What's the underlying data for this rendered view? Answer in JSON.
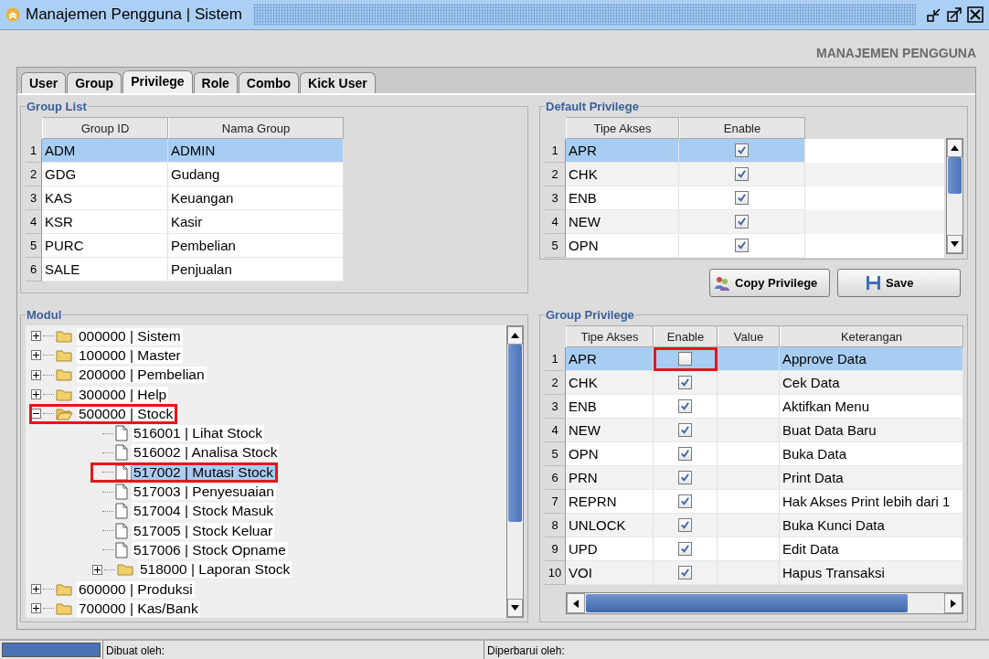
{
  "window": {
    "title": "Manajemen Pengguna | Sistem"
  },
  "header": "MANAJEMEN PENGGUNA",
  "tabs": [
    {
      "label": "User",
      "selected": false
    },
    {
      "label": "Group",
      "selected": false
    },
    {
      "label": "Privilege",
      "selected": true
    },
    {
      "label": "Role",
      "selected": false
    },
    {
      "label": "Combo",
      "selected": false
    },
    {
      "label": "Kick User",
      "selected": false
    }
  ],
  "group_list": {
    "title": "Group List",
    "columns": [
      "Group ID",
      "Nama Group"
    ],
    "rows": [
      {
        "num": "1",
        "id": "ADM",
        "name": "ADMIN",
        "selected": true
      },
      {
        "num": "2",
        "id": "GDG",
        "name": "Gudang",
        "selected": false
      },
      {
        "num": "3",
        "id": "KAS",
        "name": "Keuangan",
        "selected": false
      },
      {
        "num": "4",
        "id": "KSR",
        "name": "Kasir",
        "selected": false
      },
      {
        "num": "5",
        "id": "PURC",
        "name": "Pembelian",
        "selected": false
      },
      {
        "num": "6",
        "id": "SALE",
        "name": "Penjualan",
        "selected": false
      }
    ]
  },
  "default_privilege": {
    "title": "Default Privilege",
    "columns": [
      "Tipe Akses",
      "Enable"
    ],
    "rows": [
      {
        "num": "1",
        "type": "APR",
        "enable": true,
        "selected": true
      },
      {
        "num": "2",
        "type": "CHK",
        "enable": true,
        "selected": false
      },
      {
        "num": "3",
        "type": "ENB",
        "enable": true,
        "selected": false
      },
      {
        "num": "4",
        "type": "NEW",
        "enable": true,
        "selected": false
      },
      {
        "num": "5",
        "type": "OPN",
        "enable": true,
        "selected": false
      }
    ]
  },
  "buttons": [
    {
      "label": "Copy Privilege",
      "kind": "copy"
    },
    {
      "label": "Save",
      "kind": "save"
    }
  ],
  "modul": {
    "title": "Modul",
    "items": [
      {
        "label": "000000 | Sistem",
        "kind": "folder",
        "expanded": false,
        "selected": false,
        "highlighted": false
      },
      {
        "label": "100000 | Master",
        "kind": "folder",
        "expanded": false,
        "selected": false,
        "highlighted": false
      },
      {
        "label": "200000 | Pembelian",
        "kind": "folder",
        "expanded": false,
        "selected": false,
        "highlighted": false
      },
      {
        "label": "300000 | Help",
        "kind": "folder",
        "expanded": false,
        "selected": false,
        "highlighted": false
      },
      {
        "label": "500000 | Stock",
        "kind": "folder",
        "expanded": true,
        "selected": false,
        "highlighted": true,
        "children": [
          {
            "label": "516001 | Lihat Stock",
            "kind": "file",
            "selected": false,
            "highlighted": false
          },
          {
            "label": "516002 | Analisa Stock",
            "kind": "file",
            "selected": false,
            "highlighted": false
          },
          {
            "label": "517002 | Mutasi Stock",
            "kind": "file",
            "selected": true,
            "highlighted": true
          },
          {
            "label": "517003 | Penyesuaian",
            "kind": "file",
            "selected": false,
            "highlighted": false
          },
          {
            "label": "517004 | Stock Masuk",
            "kind": "file",
            "selected": false,
            "highlighted": false
          },
          {
            "label": "517005 | Stock Keluar",
            "kind": "file",
            "selected": false,
            "highlighted": false
          },
          {
            "label": "517006 | Stock Opname",
            "kind": "file",
            "selected": false,
            "highlighted": false
          },
          {
            "label": "518000 | Laporan Stock",
            "kind": "folder",
            "expanded": false,
            "selected": false,
            "highlighted": false
          }
        ]
      },
      {
        "label": "600000 | Produksi",
        "kind": "folder",
        "expanded": false,
        "selected": false,
        "highlighted": false
      },
      {
        "label": "700000 | Kas/Bank",
        "kind": "folder",
        "expanded": false,
        "selected": false,
        "highlighted": false
      }
    ]
  },
  "group_privilege": {
    "title": "Group Privilege",
    "columns": [
      "Tipe Akses",
      "Enable",
      "Value",
      "Keterangan"
    ],
    "rows": [
      {
        "num": "1",
        "type": "APR",
        "enable": false,
        "description": "Approve Data",
        "selected": true,
        "highlighted": true
      },
      {
        "num": "2",
        "type": "CHK",
        "enable": true,
        "description": "Cek Data",
        "selected": false,
        "highlighted": false
      },
      {
        "num": "3",
        "type": "ENB",
        "enable": true,
        "description": "Aktifkan Menu",
        "selected": false,
        "highlighted": false
      },
      {
        "num": "4",
        "type": "NEW",
        "enable": true,
        "description": "Buat Data Baru",
        "selected": false,
        "highlighted": false
      },
      {
        "num": "5",
        "type": "OPN",
        "enable": true,
        "description": "Buka Data",
        "selected": false,
        "highlighted": false
      },
      {
        "num": "6",
        "type": "PRN",
        "enable": true,
        "description": "Print Data",
        "selected": false,
        "highlighted": false
      },
      {
        "num": "7",
        "type": "REPRN",
        "enable": true,
        "description": "Hak Akses Print lebih dari 1",
        "selected": false,
        "highlighted": false
      },
      {
        "num": "8",
        "type": "UNLOCK",
        "enable": true,
        "description": "Buka Kunci Data",
        "selected": false,
        "highlighted": false
      },
      {
        "num": "9",
        "type": "UPD",
        "enable": true,
        "description": "Edit Data",
        "selected": false,
        "highlighted": false
      },
      {
        "num": "10",
        "type": "VOI",
        "enable": true,
        "description": "Hapus Transaksi",
        "selected": false,
        "highlighted": false
      }
    ]
  },
  "status_bar": {
    "created_by": "Dibuat oleh:",
    "updated_by": "Diperbarui oleh:"
  }
}
